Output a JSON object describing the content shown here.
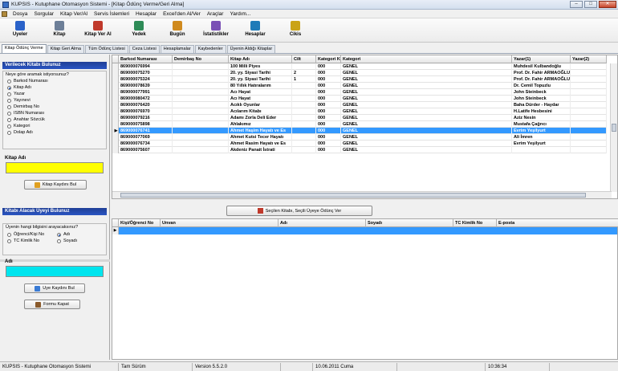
{
  "window": {
    "title": "KUPSIS - Kutuphane Otomasyon Sistemi - [Kitap Ödünç Verme/Geri Alma]",
    "minimize": "–",
    "maximize": "□",
    "close": "✕"
  },
  "menu": [
    "Dosya",
    "Sorgular",
    "Kitap Ver/Al",
    "Servis İslemleri",
    "Hesaplar",
    "Excel'den Al/Ver",
    "Araçlar",
    "Yardım..."
  ],
  "toolbar": [
    {
      "label": "Uyeler",
      "icon": "users-icon",
      "color": "#2a62c9"
    },
    {
      "label": "Kitap",
      "icon": "book-icon",
      "color": "#6d7f98"
    },
    {
      "label": "Kitap Ver Al",
      "icon": "book-exchange-icon",
      "color": "#c0392b"
    },
    {
      "label": "Yedek",
      "icon": "backup-icon",
      "color": "#2e8b57"
    },
    {
      "label": "Bugün",
      "icon": "calendar-icon",
      "color": "#d08a1e"
    },
    {
      "label": "İstatistikler",
      "icon": "stats-icon",
      "color": "#7a4fb5"
    },
    {
      "label": "Hesaplar",
      "icon": "accounts-icon",
      "color": "#1e7bb8"
    },
    {
      "label": "Cikis",
      "icon": "exit-icon",
      "color": "#caa316"
    }
  ],
  "tabs": [
    "Kitap Ödünç Verme",
    "Kitap Geri Alma",
    "Tüm Ödünç Listesi",
    "Ceza Listesi",
    "Hesaplamalar",
    "Kaybedenler",
    "Üyenin Aldığı Kitaplar"
  ],
  "left_top": {
    "header": "Verilecek Kitabı Bulunuz",
    "question": "Neye göre aramak istiyorsunuz?",
    "options": [
      "Barkod Numarası",
      "Kitap Adı",
      "Yazar",
      "Yayınevi",
      "Demirbaş No",
      "ISBN Numarası",
      "Anahtar Sözcük",
      "Kategori",
      "Dolap Adı"
    ],
    "selected_index": 1,
    "field_label": "Kitap Adı",
    "field_value": "",
    "field_color": "#ffff00",
    "button": "Kitap Kaydını Bul"
  },
  "left_bottom": {
    "header": "Kitabı Alacak Üyeyi Bulunuz",
    "question": "Üyenin hangi bilgisini arayacaksınız?",
    "options": [
      "Öğrenci/Kişi No",
      "Adı",
      "TC Kimlik No",
      "Soyadı"
    ],
    "selected_index": 1,
    "field_label": "Adı",
    "field_value": "",
    "field_color": "#00e5ee",
    "find_button": "Uye Kaydını Bul",
    "close_button": "Formu Kapat"
  },
  "book_grid": {
    "columns": [
      "Barkod Numarası",
      "Demirbaş No",
      "Kitap Adı",
      "Cilt",
      "Kategori Kodu",
      "Kategori",
      "Yazar(1)",
      "Yazar(2)"
    ],
    "selected_row": 10,
    "rows": [
      [
        "869000076994",
        "",
        "100 Milli Piyes",
        "",
        "000",
        "GENEL",
        "Muhdesil Kulbandoğlu",
        ""
      ],
      [
        "869000075270",
        "",
        "20. yy. Siyasi Tarihi",
        "2",
        "000",
        "GENEL",
        "Prof. Dr. Fahir ARMAOĞLU",
        ""
      ],
      [
        "869000075324",
        "",
        "20. yy. Siyasi Tarihi",
        "1",
        "000",
        "GENEL",
        "Prof. Dr. Fahir ARMAOĞLU",
        ""
      ],
      [
        "869000078639",
        "",
        "80 Yıllık Hatıralarım",
        "",
        "000",
        "GENEL",
        "Dr. Cemil Topuzlu",
        ""
      ],
      [
        "869000077991",
        "",
        "Acı Hayat",
        "",
        "000",
        "GENEL",
        "John Steinbeck",
        ""
      ],
      [
        "869000080472",
        "",
        "Acı Hayat",
        "",
        "000",
        "GENEL",
        "John Steinbeck",
        ""
      ],
      [
        "869000076420",
        "",
        "Acıklı Oyunlar",
        "",
        "000",
        "GENEL",
        "Baha Dürder - Haydar",
        ""
      ],
      [
        "869000076970",
        "",
        "Acılarım Kitabı",
        "",
        "000",
        "GENEL",
        "H.Latife Hesbesini",
        ""
      ],
      [
        "869000079216",
        "",
        "Adamı Zorla Deli Eder",
        "",
        "000",
        "GENEL",
        "Aziz Nesin",
        ""
      ],
      [
        "869000075898",
        "",
        "Ahlakımız",
        "",
        "000",
        "GENEL",
        "Mustafa Çağrıcı",
        ""
      ],
      [
        "869000076741",
        "",
        "Ahmet Haşim Hayatı ve Es",
        "",
        "000",
        "GENEL",
        "Evrim Yeşilyurt",
        ""
      ],
      [
        "869000077069",
        "",
        "Ahmet Kutsi Tecer Hayatı",
        "",
        "000",
        "GENEL",
        "Ali İmren",
        ""
      ],
      [
        "869000076734",
        "",
        "Ahmet Rasim Hayatı ve Es",
        "",
        "000",
        "GENEL",
        "Evrim Yeşilyurt",
        ""
      ],
      [
        "869000075607",
        "",
        "Akdeniz Panait İstrati",
        "",
        "000",
        "GENEL",
        "",
        ""
      ]
    ]
  },
  "lend_button": "Seçilen Kitabı, Seçili Üyeye Ödünç Ver",
  "member_grid": {
    "columns": [
      "Kişi/Öğrenci No",
      "Unvan",
      "Adı",
      "Soyadı",
      "TC Kimlik No",
      "E-posta"
    ]
  },
  "status": [
    "KUPSIS - Kutuphane Otomasyon Sistemi",
    "Tam Sürüm",
    "Version 5.5.2.0",
    "",
    "10.06.2011 Cuma",
    "",
    "10:36:34"
  ]
}
